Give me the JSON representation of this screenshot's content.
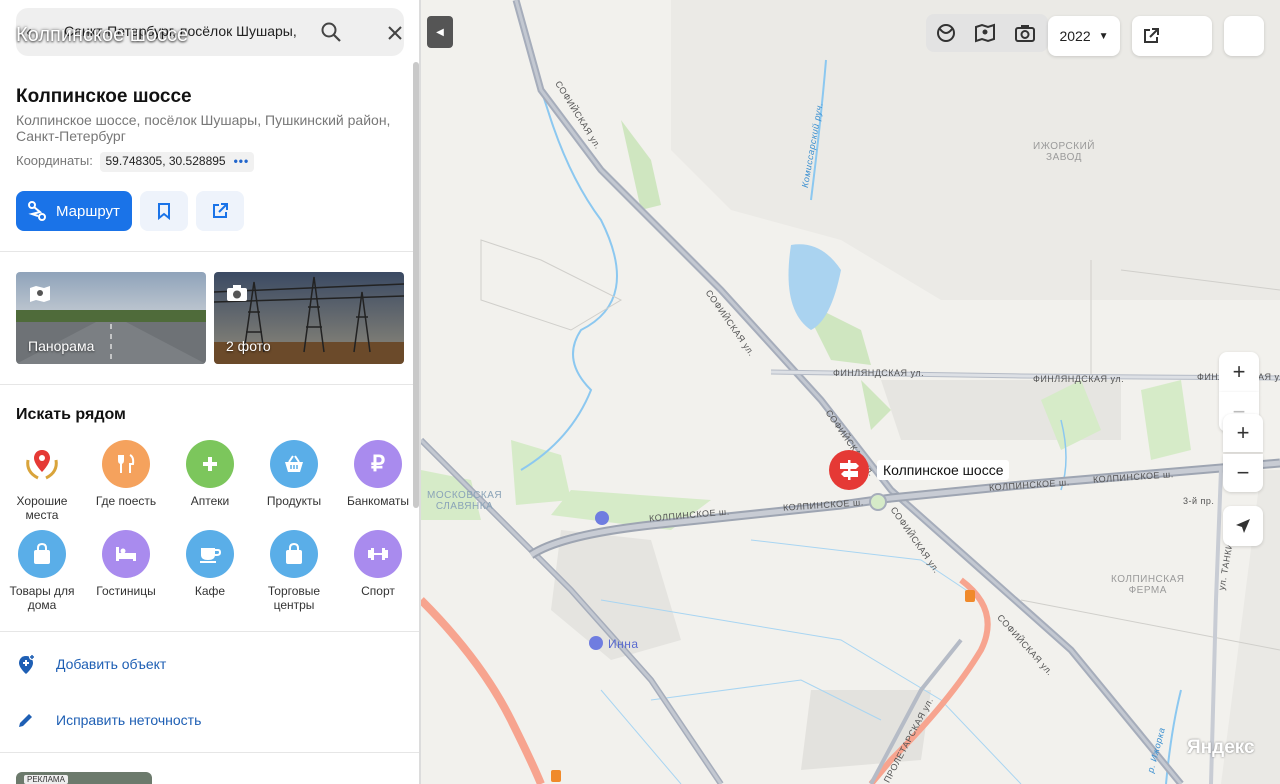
{
  "search": {
    "query": "Санкт-Петербург, посёлок Шушары,"
  },
  "place": {
    "float_title": "Колпинское шоссе",
    "title": "Колпинское шоссе",
    "address": "Колпинское шоссе, посёлок Шушары, Пушкинский район, Санкт-Петербург",
    "coords_label": "Координаты:",
    "coords_value": "59.748305, 30.528895"
  },
  "actions": {
    "route_label": "Маршрут"
  },
  "photos": {
    "panorama_label": "Панорама",
    "photos_label": "2 фото"
  },
  "nearby": {
    "title": "Искать рядом",
    "categories": [
      {
        "label": "Хорошие места",
        "icon": "laurel-pin-icon",
        "color": "#ffffff"
      },
      {
        "label": "Где поесть",
        "icon": "fork-knife-icon",
        "color": "#f5a25d"
      },
      {
        "label": "Аптеки",
        "icon": "cross-icon",
        "color": "#7cc65c"
      },
      {
        "label": "Продукты",
        "icon": "basket-icon",
        "color": "#5aaee8"
      },
      {
        "label": "Банкоматы",
        "icon": "ruble-icon",
        "color": "#a98bee"
      },
      {
        "label": "Товары для дома",
        "icon": "bag-icon",
        "color": "#5aaee8"
      },
      {
        "label": "Гостиницы",
        "icon": "bed-icon",
        "color": "#a98bee"
      },
      {
        "label": "Кафе",
        "icon": "cup-icon",
        "color": "#5aaee8"
      },
      {
        "label": "Торговые центры",
        "icon": "bag-icon",
        "color": "#5aaee8"
      },
      {
        "label": "Спорт",
        "icon": "dumbbell-icon",
        "color": "#a98bee"
      }
    ]
  },
  "links": {
    "add_object": "Добавить объект",
    "fix_error": "Исправить неточность"
  },
  "ad": {
    "label": "РЕКЛАМА"
  },
  "map": {
    "year": "2022",
    "marker_label": "Колпинское шоссе",
    "logo": "Яндекс",
    "road_labels": {
      "sofiyskaya": "СОФИЙСКАЯ ул.",
      "finlyandskaya": "ФИНЛЯНДСКАЯ ул.",
      "kolpinskoe": "КОЛПИНСКОЕ ш.",
      "proletarskaya": "ПРОЛЕТАРСКАЯ ул.",
      "komissarskiy": "Комиссарский руч.",
      "third_line": "3-й пр.",
      "tankistov": "ул. ТАНКИСТ",
      "izhorka": "р. Ижорка",
      "inna": "Инна"
    },
    "area_labels": {
      "izhorsky": "ИЖОРСКИЙ\nЗАВОД",
      "moskovskaya": "МОСКОВСКАЯ\nСЛАВЯНКА",
      "kolpinskaya": "КОЛПИНСКАЯ\nФЕРМА"
    },
    "zoom_in": "+",
    "zoom_out": "−"
  },
  "colors": {
    "accent": "#1a73e8",
    "marker": "#e53935"
  }
}
